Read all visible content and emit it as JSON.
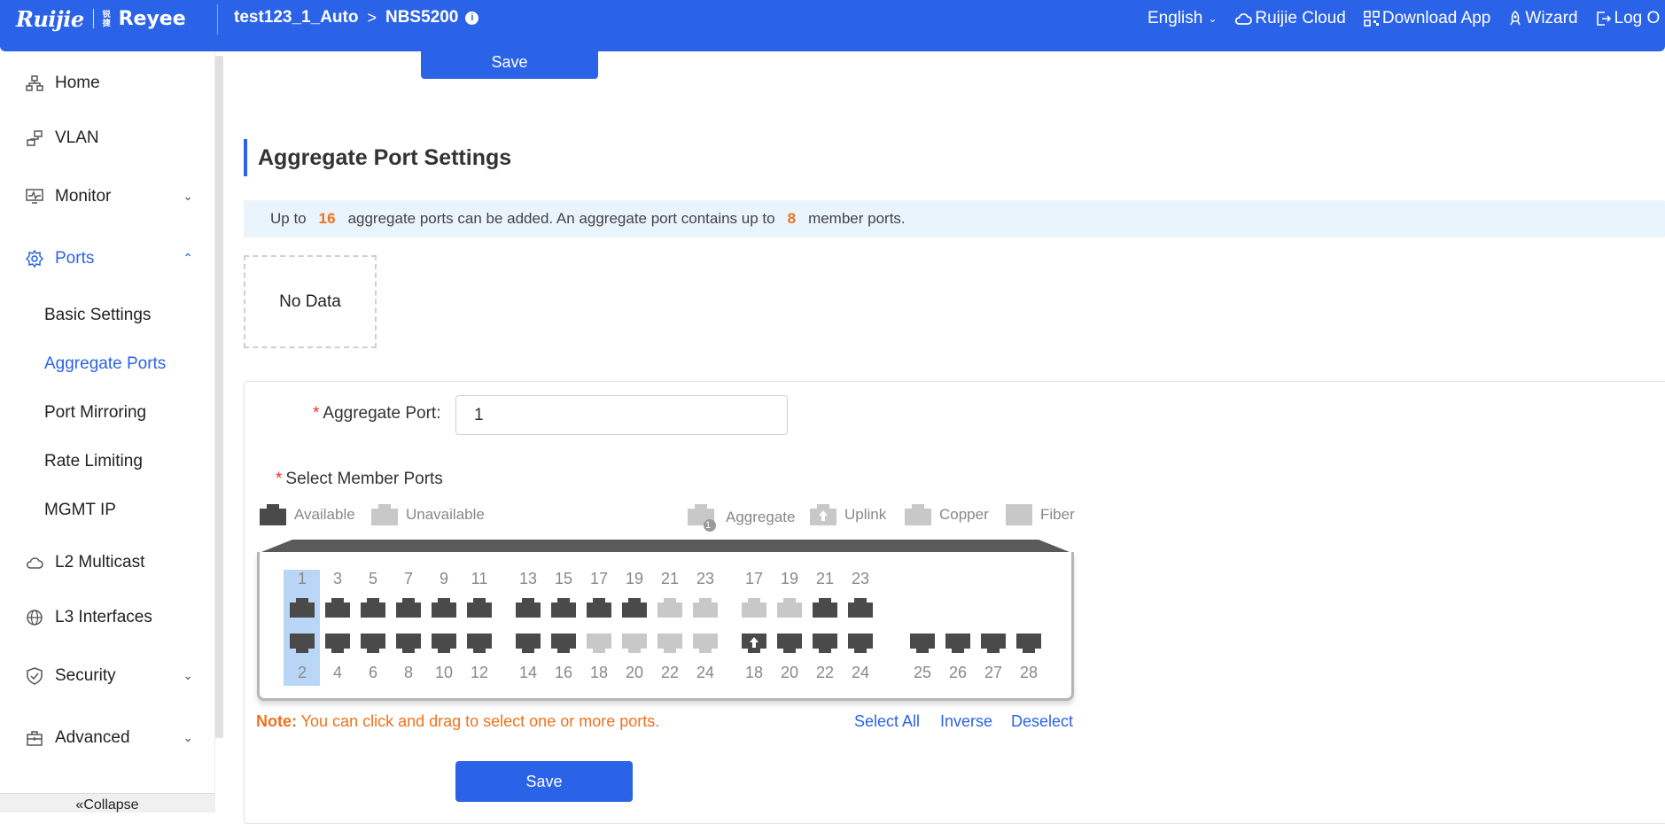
{
  "header": {
    "brand_primary": "Ruijie",
    "brand_secondary": "Reyee",
    "brand_secondary_mini": "锐捷",
    "device_name": "test123_1_Auto",
    "device_model": "NBS5200",
    "nav": {
      "language": "English",
      "cloud": "Ruijie Cloud",
      "download": "Download App",
      "wizard": "Wizard",
      "logout": "Log O"
    },
    "accent_color": "#2b63e8"
  },
  "sidebar": {
    "items": [
      {
        "label": "Home",
        "icon": "home-network-icon"
      },
      {
        "label": "VLAN",
        "icon": "vlan-icon"
      },
      {
        "label": "Monitor",
        "icon": "monitor-icon"
      },
      {
        "label": "Ports",
        "icon": "gear-icon"
      },
      {
        "label": "L2 Multicast",
        "icon": "cloud-icon"
      },
      {
        "label": "L3 Interfaces",
        "icon": "globe-icon"
      },
      {
        "label": "Security",
        "icon": "shield-icon"
      },
      {
        "label": "Advanced",
        "icon": "toolbox-icon"
      }
    ],
    "ports_submenu": [
      "Basic Settings",
      "Aggregate Ports",
      "Port Mirroring",
      "Rate Limiting",
      "MGMT IP"
    ],
    "active_submenu": "Aggregate Ports",
    "collapse_label": "Collapse"
  },
  "main": {
    "top_save_label": "Save",
    "section_title": "Aggregate Port Settings",
    "tip": {
      "part1": "Up to",
      "max_aggregate": "16",
      "part2": "aggregate ports can be added. An aggregate port contains up to",
      "max_members": "8",
      "part3": "member ports."
    },
    "no_data": "No Data",
    "form": {
      "aggregate_port_label": "Aggregate Port:",
      "aggregate_port_value": "1",
      "member_ports_label": "Select Member Ports"
    },
    "legend": {
      "available": "Available",
      "unavailable": "Unavailable",
      "aggregate": "Aggregate",
      "aggregate_badge": "1",
      "uplink": "Uplink",
      "copper": "Copper",
      "fiber": "Fiber"
    },
    "ports": {
      "top_row_group1": [
        "1",
        "3",
        "5",
        "7",
        "9",
        "11"
      ],
      "top_row_group2": [
        "13",
        "15",
        "17",
        "19",
        "21",
        "23"
      ],
      "top_row_group3": [
        "17",
        "19",
        "21",
        "23"
      ],
      "bottom_row_group1": [
        "2",
        "4",
        "6",
        "8",
        "10",
        "12"
      ],
      "bottom_row_group2": [
        "14",
        "16",
        "18",
        "20",
        "22",
        "24"
      ],
      "bottom_row_group3": [
        "18",
        "20",
        "22",
        "24"
      ],
      "bottom_row_group4": [
        "25",
        "26",
        "27",
        "28"
      ],
      "selected": [
        "1",
        "2"
      ]
    },
    "note_prefix": "Note:",
    "note_text": " You can click and drag to select one or more ports.",
    "select_all": "Select All",
    "inverse": "Inverse",
    "deselect": "Deselect",
    "save_label": "Save"
  }
}
